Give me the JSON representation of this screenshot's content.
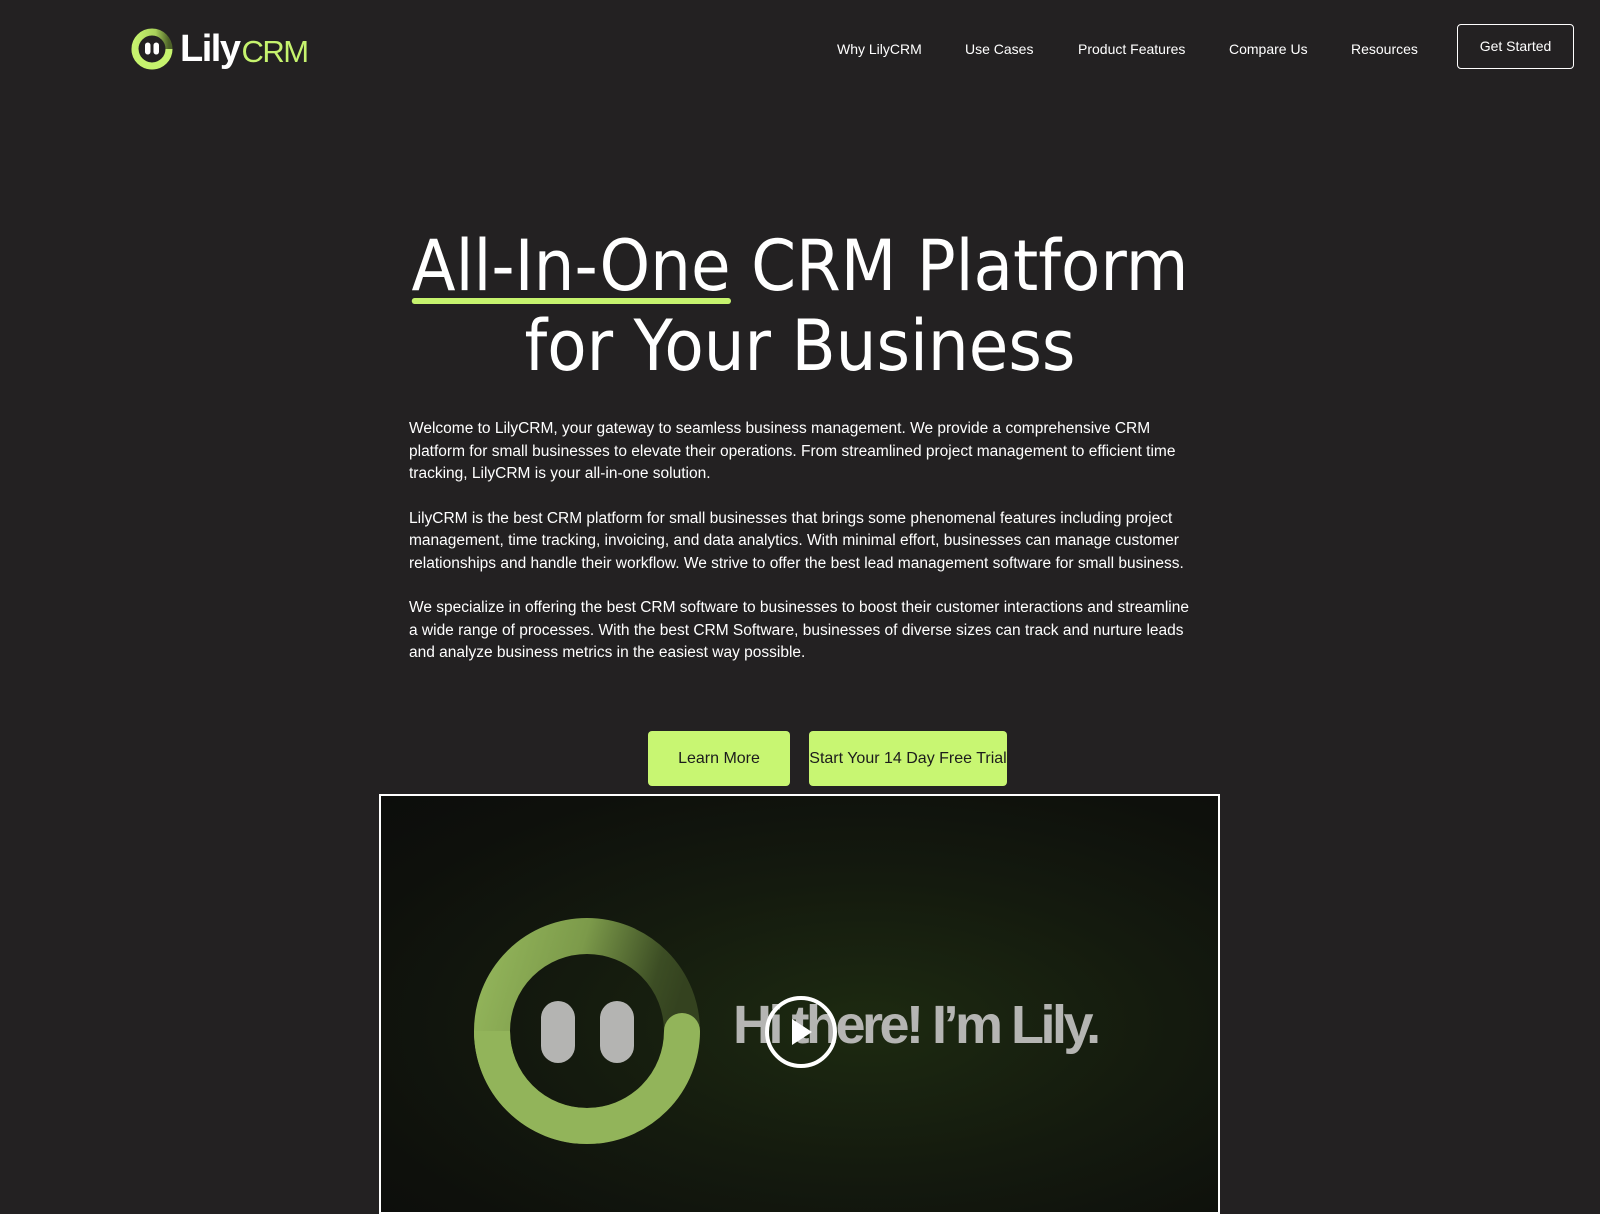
{
  "brand": {
    "name_primary": "Lily",
    "name_secondary": "CRM",
    "logo_icon": "lily-face-ring-icon",
    "accent_color": "#c6f36e",
    "background_color": "#232122"
  },
  "nav": {
    "items": [
      {
        "label": "Why LilyCRM"
      },
      {
        "label": "Use Cases"
      },
      {
        "label": "Product Features"
      },
      {
        "label": "Compare Us"
      },
      {
        "label": "Resources"
      }
    ],
    "cta_label": "Get Started"
  },
  "hero": {
    "title_highlight": "All-In-One",
    "title_rest_line1": " CRM Platform",
    "title_line2": "for Your Business",
    "paragraphs": [
      "Welcome to LilyCRM, your gateway to seamless business management. We provide a comprehensive CRM platform for small businesses to elevate their operations. From streamlined project management to efficient time tracking, LilyCRM is your all-in-one solution.",
      "LilyCRM is the best CRM platform for small businesses that brings some phenomenal features including project management, time tracking, invoicing, and data analytics. With minimal effort, businesses can manage customer relationships and handle their workflow. We strive to offer the best lead management software for small business.",
      "We specialize in offering the best CRM software to businesses to boost their customer interactions and streamline a wide range of processes. With the best CRM Software, businesses of diverse sizes can track and nurture leads and analyze business metrics in the easiest way possible."
    ],
    "buttons": {
      "learn_more": "Learn More",
      "free_trial": "Start Your 14 Day Free Trial"
    }
  },
  "video": {
    "caption": "Hi there! I’m Lily.",
    "play_icon": "play-icon"
  }
}
